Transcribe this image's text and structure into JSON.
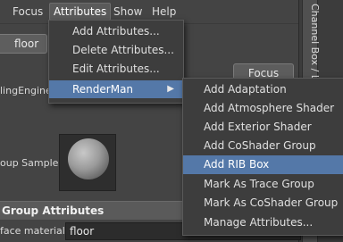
{
  "menubar": {
    "items": [
      "Focus",
      "Attributes",
      "Show",
      "Help"
    ],
    "active": "Attributes"
  },
  "channel_box": {
    "label": "Channel Box / Lay"
  },
  "editor": {
    "node_tab": "floor",
    "focus_button": "Focus",
    "engine_label": "lingEngine",
    "sample_label": "oup Sample",
    "group_header": "Group Attributes",
    "surface_label": "face material",
    "surface_value": "floor"
  },
  "attributes_menu": {
    "items": [
      "Add Attributes...",
      "Delete Attributes...",
      "Edit Attributes...",
      "RenderMan"
    ],
    "highlighted": "RenderMan",
    "submenu_arrow": "▶"
  },
  "renderman_menu": {
    "items": [
      "Add Adaptation",
      "Add Atmosphere Shader",
      "Add Exterior Shader",
      "Add CoShader Group",
      "Add RIB Box",
      "Mark As Trace Group",
      "Mark As CoShader Group",
      "Manage Attributes..."
    ],
    "highlighted": "Add RIB Box"
  },
  "colors": {
    "highlight": "#5478a8",
    "menu_bg": "#3d3d3d",
    "panel_bg": "#444444"
  }
}
